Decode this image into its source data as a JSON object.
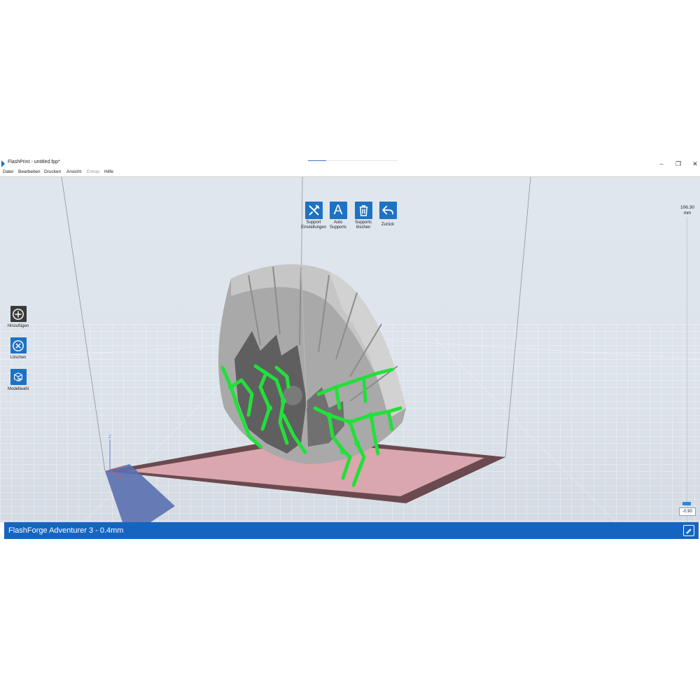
{
  "window": {
    "title": "FlashPrint - untitled.fpp*",
    "controls": [
      "–",
      "❐",
      "✕"
    ]
  },
  "menu": [
    "Datei",
    "Bearbeiten",
    "Drucken",
    "Ansicht",
    "Extras",
    "Hilfe"
  ],
  "toolbar": {
    "support_settings_label": "Support\nEinstellungen",
    "auto_supports_label": "Auto\nSupports",
    "delete_supports_label": "Supports\nlöschen",
    "back_label": "Zurück"
  },
  "left_panel": {
    "add_label": "Hinzufügen",
    "delete_label": "Löschen",
    "model_select_label": "Modellwahl"
  },
  "slider": {
    "top_value": "106.30",
    "top_unit": "mm",
    "bottom_value": "-0.90"
  },
  "axis": {
    "z_label": "Z"
  },
  "status": {
    "printer": "FlashForge Adventurer 3 - 0.4mm"
  },
  "colors": {
    "accent": "#1565c0",
    "support": "#22e03a",
    "model": "#a9a9a9",
    "bed": "#d9a7ad"
  },
  "icons": [
    "wrench-screwdriver-icon",
    "letter-a-icon",
    "trash-icon",
    "undo-arrow-icon",
    "plus-circle-icon",
    "x-circle-icon",
    "cube-cursor-icon",
    "edit-icon"
  ]
}
